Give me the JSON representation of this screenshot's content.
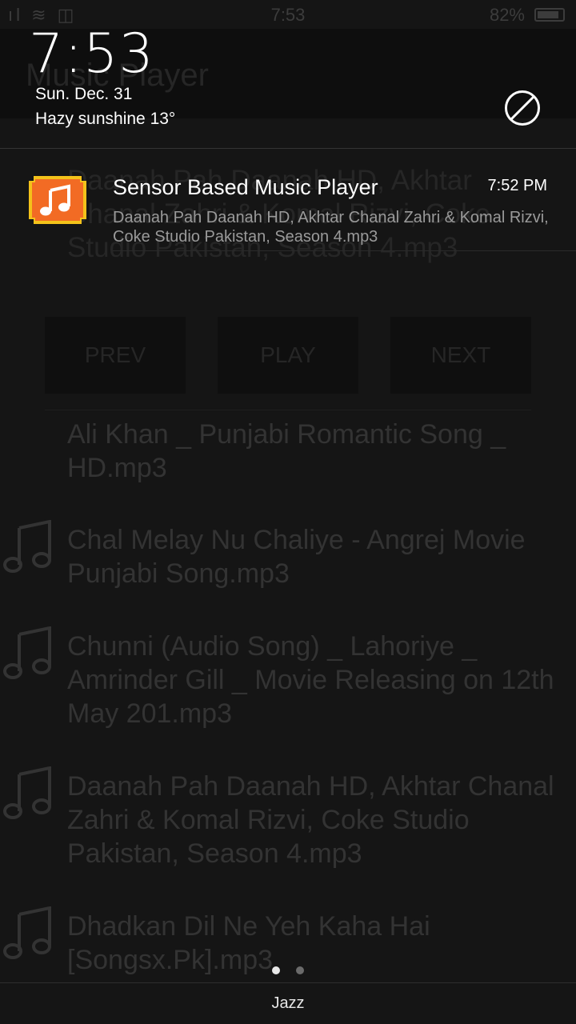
{
  "background_app": {
    "status_bar": {
      "time": "7:53",
      "battery": "82%"
    },
    "title": "Music Player",
    "now_playing": "Daanah Pah Daanah HD, Akhtar Chanal Zahri & Komal Rizvi, Coke Studio Pakistan, Season 4.mp3",
    "controls": {
      "prev": "PREV",
      "play": "PLAY",
      "next": "NEXT"
    },
    "songs": [
      "Ali Khan _ Punjabi Romantic Song _ HD.mp3",
      "Chal Melay Nu Chaliye - Angrej Movie Punjabi Song.mp3",
      "Chunni (Audio Song) _ Lahoriye _ Amrinder Gill _ Movie Releasing on 12th May 201.mp3",
      "Daanah Pah Daanah HD, Akhtar Chanal Zahri & Komal Rizvi, Coke Studio Pakistan, Season 4.mp3",
      "Dhadkan Dil Ne Yeh Kaha Hai [Songsx.Pk].mp3"
    ]
  },
  "shade": {
    "clock": "7:53",
    "date": "Sun. Dec. 31",
    "weather": "Hazy sunshine 13°",
    "dnd_icon": "do-not-disturb-icon"
  },
  "notification": {
    "app_icon": "music-note-icon",
    "title": "Sensor Based Music Player",
    "time": "7:52 PM",
    "text": "Daanah Pah Daanah HD, Akhtar Chanal Zahri & Komal Rizvi, Coke Studio Pakistan, Season 4.mp3"
  },
  "bottom": {
    "carrier": "Jazz"
  },
  "colors": {
    "notification_icon_bg": "#f26b24",
    "notification_icon_border": "#f4c21a"
  }
}
